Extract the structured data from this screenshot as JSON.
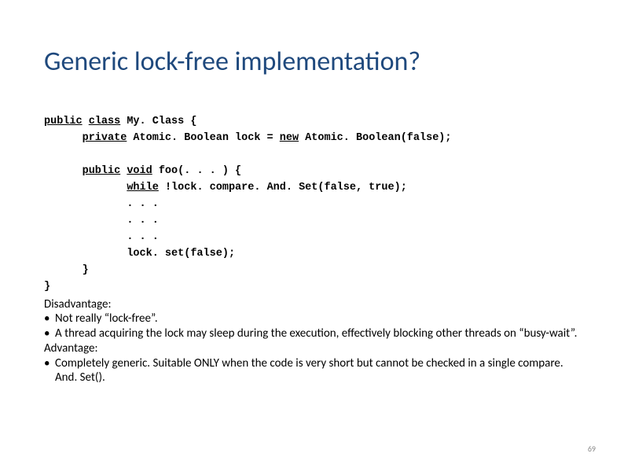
{
  "title": "Generic lock-free implementation?",
  "code": {
    "kw_public1": "public",
    "kw_class": "class",
    "class_decl_rest": " My. Class {",
    "indent1": "      ",
    "kw_private": "private",
    "field_rest": " Atomic. Boolean lock = ",
    "kw_new": "new",
    "field_rest2": " Atomic. Boolean(false);",
    "blank": "",
    "kw_public2": "public",
    "kw_void": "void",
    "method_rest": " foo(. . . ) {",
    "indent2": "             ",
    "kw_while": "while",
    "while_rest": " !lock. compare. And. Set(false, true);",
    "dots": "             . . .",
    "setline": "             lock. set(false);",
    "close_method": "      }",
    "close_class": "}"
  },
  "body": {
    "disadvantage_label": "Disadvantage:",
    "b1": "Not really “lock-free”.",
    "b2": "A thread acquiring the lock may sleep during the execution, effectively blocking other threads on “busy-wait”.",
    "advantage_label": "Advantage:",
    "b3": "Completely generic. Suitable ONLY when the code is very short but cannot be checked in a single compare. And. Set().",
    "bullet_char": "•"
  },
  "page_number": "69"
}
